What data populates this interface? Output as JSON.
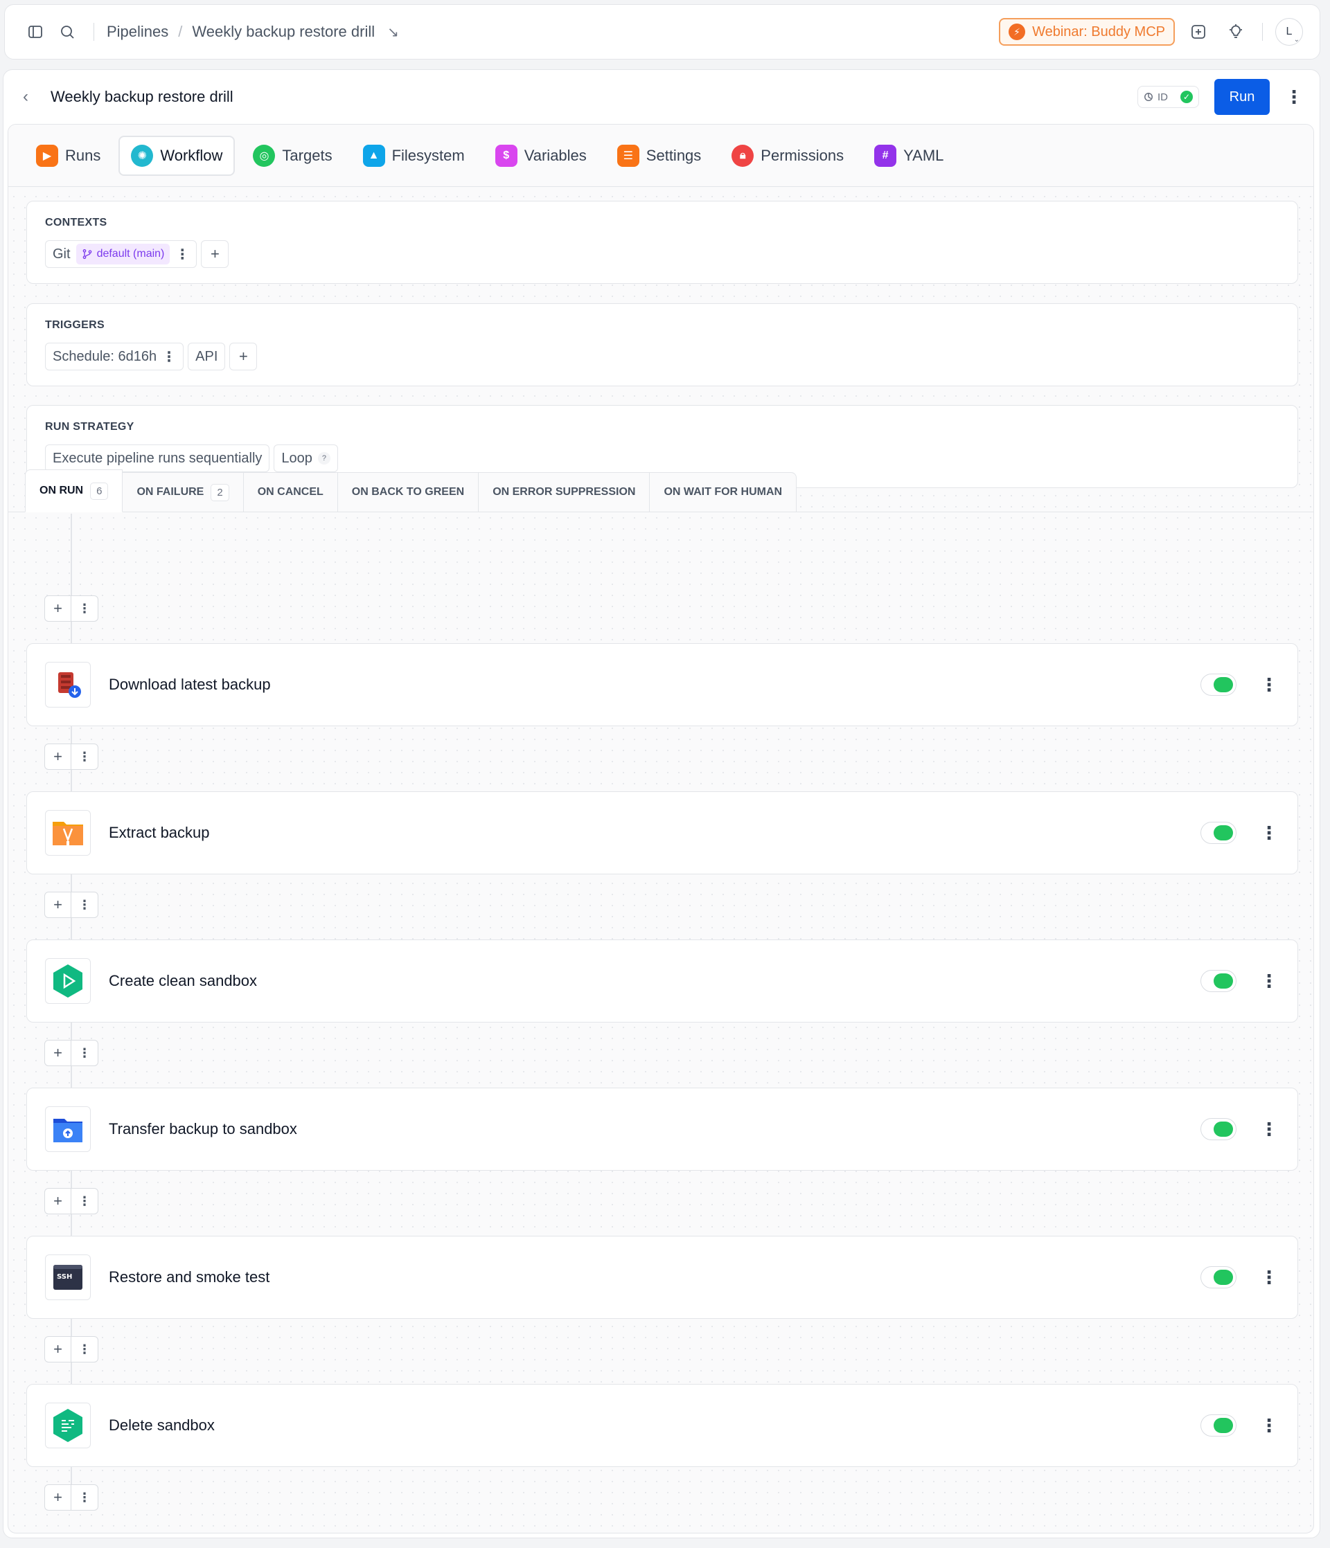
{
  "topbar": {
    "breadcrumb_root": "Pipelines",
    "breadcrumb_current": "Weekly backup restore drill",
    "webinar_label": "Webinar: Buddy MCP",
    "avatar_initial": "L"
  },
  "header": {
    "title": "Weekly backup restore drill",
    "id_label": "ID",
    "run_label": "Run"
  },
  "tabs": [
    {
      "label": "Runs",
      "icon": "runs-icon",
      "color": "#f97316"
    },
    {
      "label": "Workflow",
      "icon": "workflow-icon",
      "color": "#22b8cf"
    },
    {
      "label": "Targets",
      "icon": "targets-icon",
      "color": "#22c55e"
    },
    {
      "label": "Filesystem",
      "icon": "filesystem-icon",
      "color": "#0ea5e9"
    },
    {
      "label": "Variables",
      "icon": "variables-icon",
      "color": "#d946ef"
    },
    {
      "label": "Settings",
      "icon": "settings-icon",
      "color": "#f97316"
    },
    {
      "label": "Permissions",
      "icon": "permissions-icon",
      "color": "#ef4444"
    },
    {
      "label": "YAML",
      "icon": "yaml-icon",
      "color": "#9333ea"
    }
  ],
  "contexts": {
    "label": "CONTEXTS",
    "git_label": "Git",
    "branch": "default (main)"
  },
  "triggers": {
    "label": "TRIGGERS",
    "schedule": "Schedule: 6d16h",
    "api": "API"
  },
  "run_strategy": {
    "label": "RUN STRATEGY",
    "mode": "Execute pipeline runs sequentially",
    "loop": "Loop",
    "help": "?"
  },
  "action_tabs": [
    {
      "label": "ON RUN",
      "count": "6"
    },
    {
      "label": "ON FAILURE",
      "count": "2"
    },
    {
      "label": "ON CANCEL"
    },
    {
      "label": "ON BACK TO GREEN"
    },
    {
      "label": "ON ERROR SUPPRESSION"
    },
    {
      "label": "ON WAIT FOR HUMAN"
    }
  ],
  "actions": [
    {
      "name": "Download latest backup",
      "icon": "s3-download-icon",
      "enabled": true
    },
    {
      "name": "Extract backup",
      "icon": "zip-archive-icon",
      "enabled": true
    },
    {
      "name": "Create clean sandbox",
      "icon": "sandbox-create-icon",
      "enabled": true
    },
    {
      "name": "Transfer backup to sandbox",
      "icon": "folder-upload-icon",
      "enabled": true
    },
    {
      "name": "Restore and smoke test",
      "icon": "ssh-terminal-icon",
      "enabled": true
    },
    {
      "name": "Delete sandbox",
      "icon": "sandbox-delete-icon",
      "enabled": true
    }
  ],
  "colors": {
    "accent": "#0b5de6",
    "toggle_on": "#22c55e",
    "webinar": "#ef7a2e"
  }
}
